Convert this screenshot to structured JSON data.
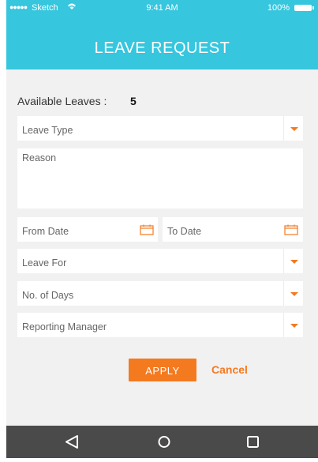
{
  "status_bar": {
    "carrier": "Sketch",
    "time": "9:41 AM",
    "battery": "100%"
  },
  "header": {
    "title": "LEAVE REQUEST"
  },
  "available": {
    "label": "Available Leaves :",
    "value": "5"
  },
  "form": {
    "leave_type_placeholder": "Leave Type",
    "reason_placeholder": "Reason",
    "from_date_placeholder": "From Date",
    "to_date_placeholder": "To Date",
    "leave_for_placeholder": "Leave For",
    "days_placeholder": "No. of Days",
    "manager_placeholder": "Reporting Manager"
  },
  "actions": {
    "apply_label": "APPLY",
    "cancel_label": "Cancel"
  },
  "colors": {
    "header": "#36c6de",
    "accent": "#f47a20",
    "navbar": "#4a4a4a",
    "background": "#f1f1f1"
  },
  "nav_icons": [
    "back-icon",
    "home-icon",
    "recents-icon"
  ]
}
